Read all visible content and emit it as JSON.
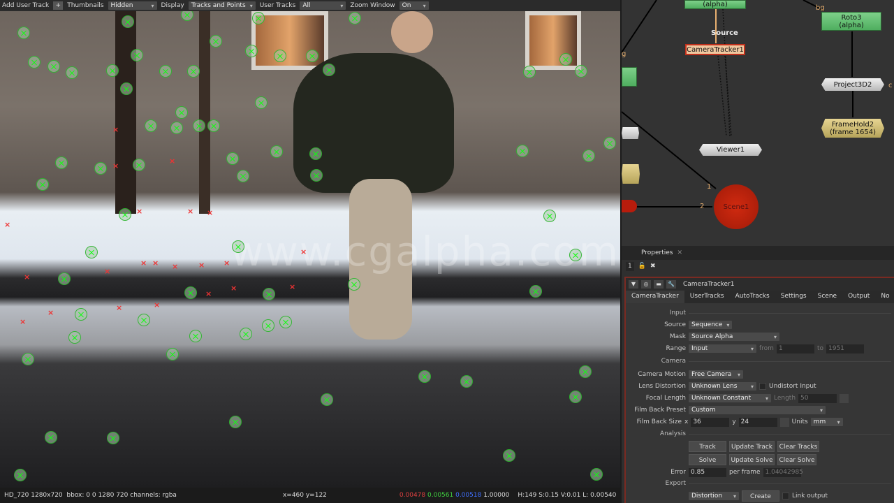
{
  "viewer": {
    "toolbar": {
      "add_user_track": "Add User Track",
      "thumbnails_label": "Thumbnails",
      "thumbnails_value": "Hidden",
      "display_label": "Display",
      "display_value": "Tracks and Points",
      "user_tracks_label": "User Tracks",
      "user_tracks_value": "All",
      "zoom_window_label": "Zoom Window",
      "zoom_window_value": "On"
    },
    "watermark": "www.cgalpha.com",
    "status": {
      "format": "HD_720 1280x720",
      "bbox": "bbox: 0 0 1280 720",
      "channels": "channels: rgba",
      "coords": "x=460 y=122",
      "r": "0.00478",
      "g": "0.00561",
      "b": "0.00518",
      "a": "1.00000",
      "hsvl": "H:149 S:0.15 V:0.01  L: 0.00540"
    },
    "colors": {
      "r": "#e04040",
      "g": "#40d040",
      "b": "#4070ff",
      "track": "#22ee22",
      "rejected": "#ee3333"
    }
  },
  "node_graph": {
    "nodes": {
      "top_alpha": "(alpha)",
      "roto3": "Roto3",
      "roto3_sub": "(alpha)",
      "source_label": "Source",
      "camera_tracker": "CameraTracker1",
      "project3d": "Project3D2",
      "framehold": "FrameHold2",
      "framehold_sub": "(frame 1654)",
      "viewer": "Viewer1",
      "scene": "Scene1"
    },
    "labels": {
      "bg": "bg",
      "g": "g",
      "in1": "1",
      "in2": "2",
      "c": "c"
    }
  },
  "properties": {
    "tab": "Properties",
    "count": "1",
    "node_name": "CameraTracker1",
    "tabs": [
      "CameraTracker",
      "UserTracks",
      "AutoTracks",
      "Settings",
      "Scene",
      "Output",
      "No"
    ],
    "input_section": "Input",
    "source": {
      "label": "Source",
      "value": "Sequence"
    },
    "mask": {
      "label": "Mask",
      "value": "Source Alpha"
    },
    "range": {
      "label": "Range",
      "value": "Input",
      "from_label": "from",
      "from": "1",
      "to_label": "to",
      "to": "1951"
    },
    "camera_section": "Camera",
    "camera_motion": {
      "label": "Camera Motion",
      "value": "Free Camera"
    },
    "lens_distortion": {
      "label": "Lens Distortion",
      "value": "Unknown Lens",
      "undistort": "Undistort Input"
    },
    "focal_length": {
      "label": "Focal Length",
      "value": "Unknown Constant",
      "length_label": "Length",
      "length": "50"
    },
    "film_back_preset": {
      "label": "Film Back Preset",
      "value": "Custom"
    },
    "film_back_size": {
      "label": "Film Back Size",
      "x_label": "x",
      "x": "36",
      "y_label": "y",
      "y": "24",
      "units_label": "Units",
      "units": "mm"
    },
    "analysis_section": "Analysis",
    "buttons": {
      "track": "Track",
      "update_track": "Update Track",
      "clear_tracks": "Clear Tracks",
      "solve": "Solve",
      "update_solve": "Update Solve",
      "clear_solve": "Clear Solve"
    },
    "error": {
      "label": "Error",
      "value": "0.85",
      "per_frame_label": "per frame",
      "per_frame": "1.04042985"
    },
    "export_section": "Export",
    "export": {
      "value": "Distortion",
      "create": "Create",
      "link_output": "Link output"
    }
  }
}
